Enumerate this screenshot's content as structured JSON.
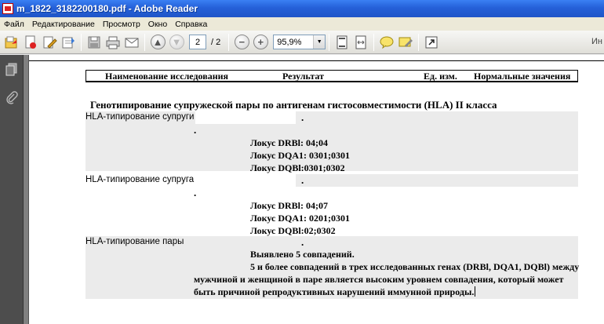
{
  "window": {
    "title": "m_1822_3182200180.pdf - Adobe Reader"
  },
  "menu": [
    "Файл",
    "Редактирование",
    "Просмотр",
    "Окно",
    "Справка"
  ],
  "toolbar": {
    "page_current": "2",
    "page_total": "/ 2",
    "zoom": "95,9%",
    "extra": "Ин"
  },
  "table_header": {
    "name": "Наименование исследования",
    "result": "Результат",
    "unit": "Ед. изм.",
    "norm": "Нормальные значения"
  },
  "section_title": "Генотипирование супружеской пары по антигенам гистосовместимости (HLA) II класса",
  "rows": [
    {
      "label": "HLA-типирование супруги",
      "dot_top": ".",
      "dot_mid": ".",
      "lines": [
        "Локус DRBl: 04;04",
        "Локус DQA1: 0301;0301",
        "Локус DQBl:0301;0302"
      ]
    },
    {
      "label": "HLA-типирование супруга",
      "dot_top": ".",
      "dot_mid": ".",
      "lines": [
        "Локус DRBl: 04;07",
        "Локус DQA1: 0201;0301",
        "Локус DQBl:02;0302"
      ]
    },
    {
      "label": "HLA-типирование пары",
      "dot_top": ".",
      "lines": [
        "Выявлено 5 совпадений.",
        "5 и более совпадений в трех исследованных генах (DRBl, DQA1, DQBl) между",
        "мужчиной и женщиной в паре является высоким уровнем совпадения, который может",
        "быть причиной репродуктивных нарушений иммунной природы."
      ]
    }
  ],
  "colors": {
    "titlebar": "#2560d8",
    "row_bg": "#ebebeb",
    "nav": "#4d4d4d"
  }
}
